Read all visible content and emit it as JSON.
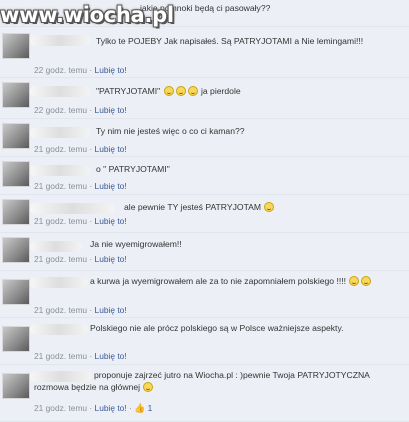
{
  "watermark": "www.wiocha.pl",
  "like_label": "Lubię to!",
  "comments": [
    {
      "text": "jakie pomnoki będą ci pasowały??",
      "time": ""
    },
    {
      "text": "Tylko te POJEBY Jak napisałeś. Są PATRYJOTAMI a Nie lemingami!!!",
      "time": "22 godz. temu"
    },
    {
      "text": "\"PATRYJOTAMI\"",
      "text2": "ja pierdole",
      "time": "22 godz. temu"
    },
    {
      "text": "Ty nim nie jesteś więc o co ci kaman??",
      "time": "21 godz. temu"
    },
    {
      "text": "o \" PATRYJOTAMI\"",
      "time": "21 godz. temu"
    },
    {
      "text": "ale pewnie TY jesteś PATRYJOTAM",
      "time": "21 godz. temu"
    },
    {
      "text": "Ja nie wyemigrowałem!!",
      "time": "21 godz. temu"
    },
    {
      "text": "a kurwa ja wyemigrowałem ale za to nie zapomniałem polskiego !!!!",
      "time": "21 godz. temu"
    },
    {
      "text": "Polskiego nie ale prócz polskiego są w Polsce ważniejsze aspekty.",
      "time": "21 godz. temu"
    },
    {
      "text": "proponuje zajrzeć jutro na Wiocha.pl : )pewnie Twoja PATRYJOTYCZNA rozmowa będzie na głównej",
      "time": "21 godz. temu",
      "likes": "1"
    }
  ],
  "colors": {
    "background": "#eceff5",
    "link": "#3b5998",
    "meta": "#898f9c"
  }
}
